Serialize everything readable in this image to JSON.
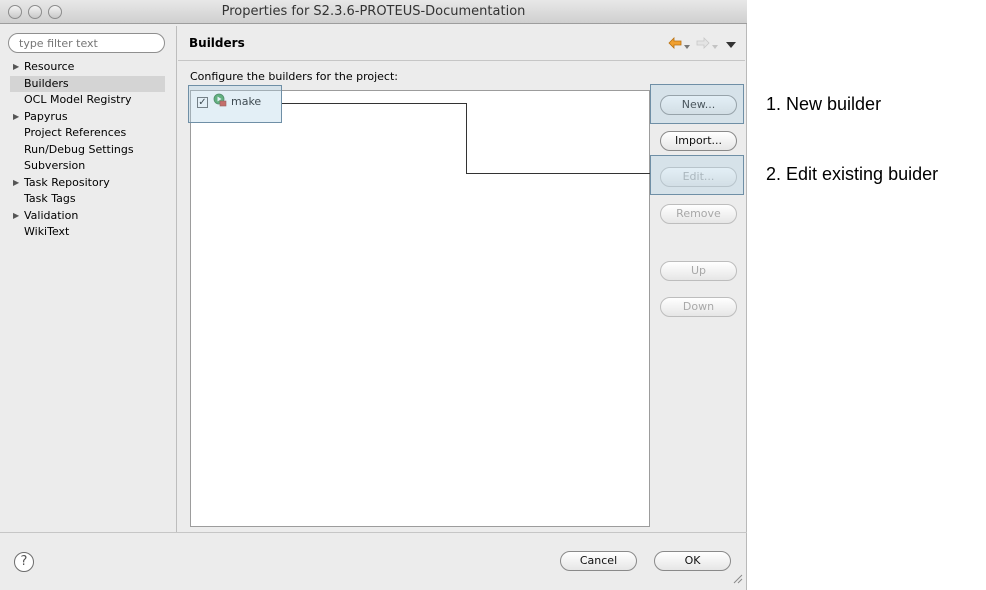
{
  "window": {
    "title": "Properties for S2.3.6-PROTEUS-Documentation"
  },
  "sidebar": {
    "filter_placeholder": "type filter text",
    "items": [
      {
        "label": "Resource",
        "expandable": true
      },
      {
        "label": "Builders",
        "selected": true
      },
      {
        "label": "OCL Model Registry"
      },
      {
        "label": "Papyrus",
        "expandable": true
      },
      {
        "label": "Project References"
      },
      {
        "label": "Run/Debug Settings"
      },
      {
        "label": "Subversion"
      },
      {
        "label": "Task Repository",
        "expandable": true
      },
      {
        "label": "Task Tags"
      },
      {
        "label": "Validation",
        "expandable": true
      },
      {
        "label": "WikiText"
      }
    ]
  },
  "page": {
    "title": "Builders",
    "description": "Configure the builders for the project:",
    "builders": [
      {
        "name": "make",
        "checked": true
      }
    ],
    "buttons": {
      "new": "New...",
      "import": "Import...",
      "edit": "Edit...",
      "remove": "Remove",
      "up": "Up",
      "down": "Down"
    }
  },
  "footer": {
    "help": "?",
    "cancel": "Cancel",
    "ok": "OK"
  },
  "annotations": {
    "new_builder": "1. New builder",
    "edit_builder": "2. Edit existing buider"
  },
  "colors": {
    "window_bg": "#ececec",
    "selection": "#d4d4d4",
    "highlight": "#afd2e6",
    "history_arrow": "#f0a030",
    "run_icon_green": "#3aa04a",
    "run_icon_red": "#d03a2a"
  }
}
